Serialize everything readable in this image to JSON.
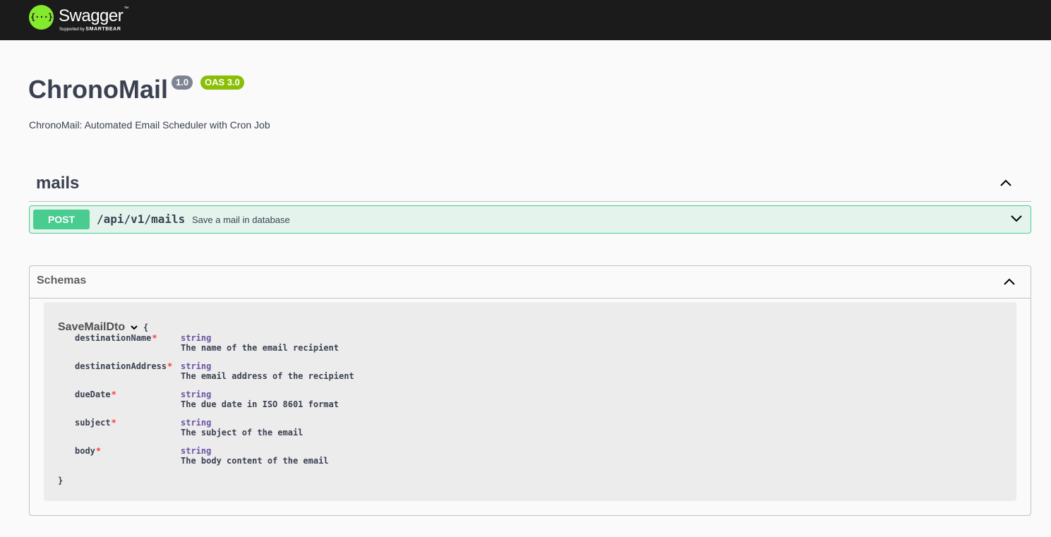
{
  "topbar": {
    "logo_glyph": "{···}",
    "brand": "Swagger",
    "tm": "™",
    "supported_by": "Supported by",
    "sponsor": "SMARTBEAR"
  },
  "info": {
    "title": "ChronoMail",
    "version": "1.0",
    "oas": "OAS 3.0",
    "description": "ChronoMail: Automated Email Scheduler with Cron Job"
  },
  "tag": {
    "name": "mails",
    "chevron": "chevron-up-icon"
  },
  "operation": {
    "method": "POST",
    "path": "/api/v1/mails",
    "summary": "Save a mail in database",
    "chevron": "chevron-down-icon"
  },
  "schemas": {
    "title": "Schemas",
    "model": {
      "name": "SaveMailDto",
      "open_brace": "{",
      "close_brace": "}",
      "required_mark": "*",
      "properties": [
        {
          "name": "destinationName",
          "type": "string",
          "description": "The name of the email recipient"
        },
        {
          "name": "destinationAddress",
          "type": "string",
          "description": "The email address of the recipient"
        },
        {
          "name": "dueDate",
          "type": "string",
          "description": "The due date in ISO 8601 format"
        },
        {
          "name": "subject",
          "type": "string",
          "description": "The subject of the email"
        },
        {
          "name": "body",
          "type": "string",
          "description": "The body content of the email"
        }
      ]
    }
  },
  "colors": {
    "topbar": "#1b1b1b",
    "logo": "#85ea2d",
    "post": "#49cc90",
    "badge_version": "#7d8492",
    "badge_oas": "#89bf04",
    "required": "#f93e3e"
  }
}
